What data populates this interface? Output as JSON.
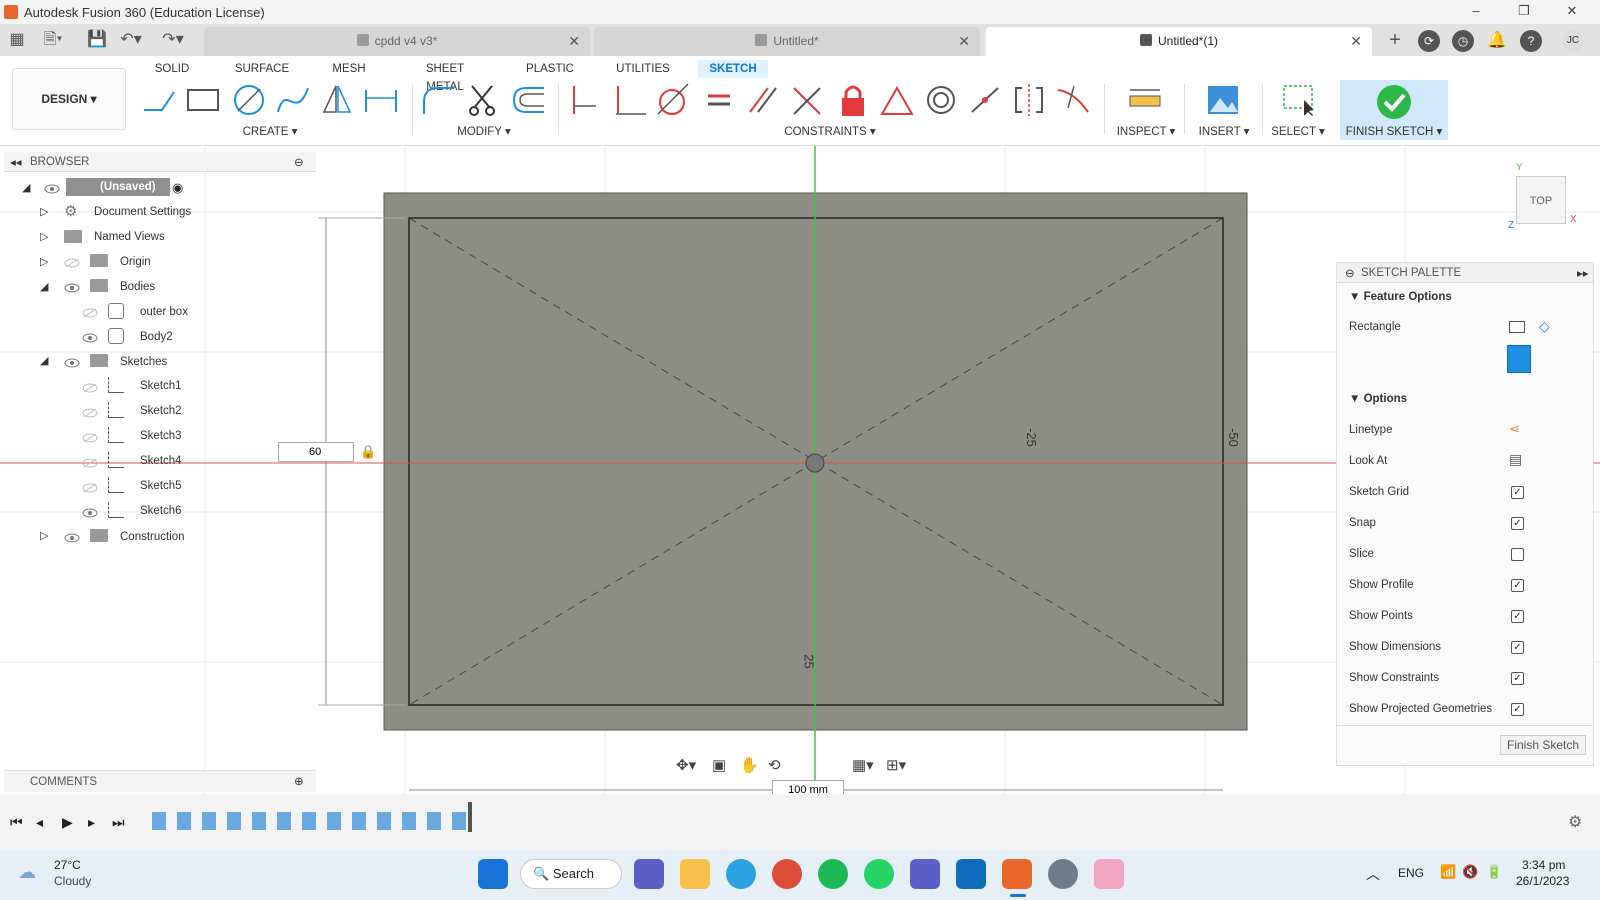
{
  "window": {
    "title": "Autodesk Fusion 360 (Education License)",
    "controls": [
      "–",
      "❐",
      "✕"
    ]
  },
  "tabs": [
    {
      "label": "cpdd v4 v3*"
    },
    {
      "label": "Untitled*"
    },
    {
      "label": "Untitled*(1)"
    }
  ],
  "workspace": {
    "label": "DESIGN ▾",
    "tabs": [
      "SOLID",
      "SURFACE",
      "MESH",
      "SHEET METAL",
      "PLASTIC",
      "UTILITIES",
      "SKETCH"
    ],
    "active_tab": "SKETCH"
  },
  "groups": {
    "create": "CREATE ▾",
    "modify": "MODIFY ▾",
    "constraints": "CONSTRAINTS ▾",
    "inspect": "INSPECT ▾",
    "insert": "INSERT ▾",
    "select": "SELECT ▾",
    "finish": "FINISH SKETCH ▾"
  },
  "browser": {
    "title": "BROWSER",
    "root": "(Unsaved)",
    "items": [
      {
        "label": "Document Settings"
      },
      {
        "label": "Named Views"
      },
      {
        "label": "Origin"
      },
      {
        "label": "Bodies"
      },
      {
        "label": "outer box"
      },
      {
        "label": "Body2"
      },
      {
        "label": "Sketches"
      },
      {
        "label": "Sketch1"
      },
      {
        "label": "Sketch2"
      },
      {
        "label": "Sketch3"
      },
      {
        "label": "Sketch4"
      },
      {
        "label": "Sketch5"
      },
      {
        "label": "Sketch6"
      },
      {
        "label": "Construction"
      }
    ]
  },
  "comments": {
    "title": "COMMENTS"
  },
  "viewcube": {
    "face": "TOP",
    "axes": {
      "y": "Y",
      "x": "X",
      "z": "Z"
    }
  },
  "canvas": {
    "dim_input_value": "60",
    "dim_h_input": "100 mm",
    "dim_labels": [
      "-25",
      "-50",
      "25"
    ]
  },
  "palette": {
    "title": "SKETCH PALETTE",
    "feature_options": "Feature Options",
    "rectangle_label": "Rectangle",
    "options": "Options",
    "rows": [
      {
        "label": "Linetype",
        "type": "icon"
      },
      {
        "label": "Look At",
        "type": "icon"
      },
      {
        "label": "Sketch Grid",
        "checked": true
      },
      {
        "label": "Snap",
        "checked": true
      },
      {
        "label": "Slice",
        "checked": false
      },
      {
        "label": "Show Profile",
        "checked": true
      },
      {
        "label": "Show Points",
        "checked": true
      },
      {
        "label": "Show Dimensions",
        "checked": true
      },
      {
        "label": "Show Constraints",
        "checked": true
      },
      {
        "label": "Show Projected Geometries",
        "checked": true
      }
    ],
    "finish_button": "Finish Sketch"
  },
  "taskbar": {
    "temp": "27°C",
    "weather": "Cloudy",
    "search": "Search",
    "lang": "ENG",
    "time": "3:34 pm",
    "date": "26/1/2023"
  },
  "colors": {
    "accent": "#0a7ad4",
    "sketch_fill": "#8d8f84",
    "finish_green": "#2fb84a",
    "axis_red": "#e05050",
    "axis_green": "#3cc83c"
  }
}
